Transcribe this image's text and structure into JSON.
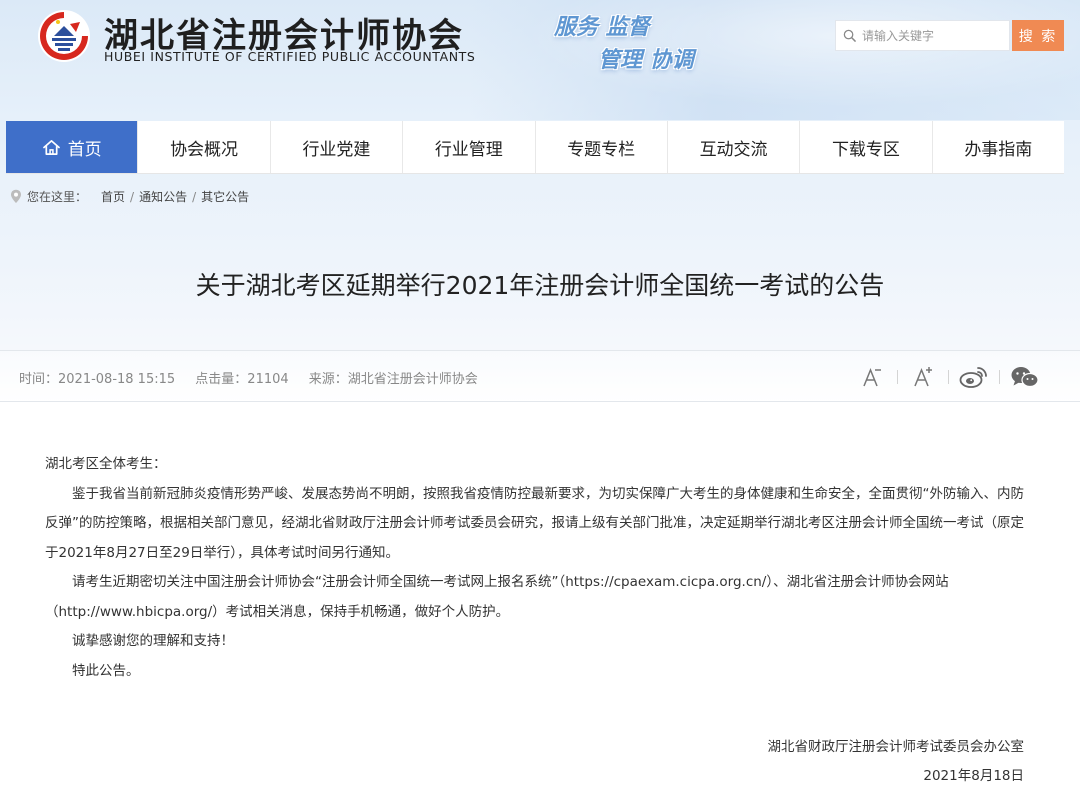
{
  "header": {
    "brand_cn": "湖北省注册会计师协会",
    "brand_en": "HUBEI INSTITUTE OF CERTIFIED PUBLIC ACCOUNTANTS",
    "slogan_line1": "服务 监督",
    "slogan_line2": "管理 协调"
  },
  "search": {
    "placeholder": "请输入关键字",
    "button_label": "搜 索"
  },
  "nav": {
    "items": [
      {
        "label": "首页",
        "active": true
      },
      {
        "label": "协会概况"
      },
      {
        "label": "行业党建"
      },
      {
        "label": "行业管理"
      },
      {
        "label": "专题专栏"
      },
      {
        "label": "互动交流"
      },
      {
        "label": "下载专区"
      },
      {
        "label": "办事指南"
      }
    ]
  },
  "breadcrumb": {
    "label": "您在这里：",
    "items": [
      "首页",
      "通知公告",
      "其它公告"
    ],
    "separator": "/"
  },
  "article": {
    "title": "关于湖北考区延期举行2021年注册会计师全国统一考试的公告",
    "meta": {
      "time": "时间：2021-08-18 15:15",
      "views": "点击量：21104",
      "source": "来源：湖北省注册会计师协会"
    },
    "paragraphs": [
      "湖北考区全体考生：",
      "鉴于我省当前新冠肺炎疫情形势严峻、发展态势尚不明朗，按照我省疫情防控最新要求，为切实保障广大考生的身体健康和生命安全，全面贯彻“外防输入、内防反弹”的防控策略，根据相关部门意见，经湖北省财政厅注册会计师考试委员会研究，报请上级有关部门批准，决定延期举行湖北考区注册会计师全国统一考试（原定于2021年8月27日至29日举行），具体考试时间另行通知。",
      "请考生近期密切关注中国注册会计师协会“注册会计师全国统一考试网上报名系统”（https://cpaexam.cicpa.org.cn/）、湖北省注册会计师协会网站（http://www.hbicpa.org/）考试相关消息，保持手机畅通，做好个人防护。",
      "诚挚感谢您的理解和支持！",
      "特此公告。"
    ],
    "signature": "湖北省财政厅注册会计师考试委员会办公室",
    "date": "2021年8月18日"
  },
  "icons": {
    "logo": "association-emblem",
    "search": "search-icon",
    "home": "home-icon",
    "location": "location-pin-icon",
    "font_decrease": "font-decrease-icon",
    "font_increase": "font-increase-icon",
    "weibo": "weibo-icon",
    "wechat": "wechat-icon"
  },
  "colors": {
    "nav_active": "#3f6fc9",
    "search_button": "#f08a53",
    "slogan": "#5f97d2",
    "logo_red": "#d7281e"
  }
}
